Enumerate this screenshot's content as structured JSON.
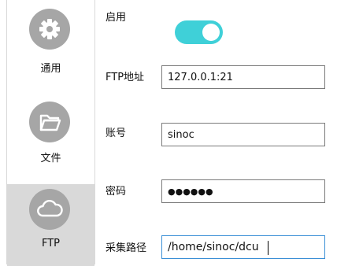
{
  "sidebar": {
    "items": [
      {
        "label": "通用",
        "icon": "gear-icon"
      },
      {
        "label": "文件",
        "icon": "folder-icon"
      },
      {
        "label": "FTP",
        "icon": "cloud-icon"
      }
    ],
    "active_index": 2
  },
  "form": {
    "enable": {
      "label": "启用",
      "on": true
    },
    "ftp_address": {
      "label": "FTP地址",
      "value": "127.0.0.1:21"
    },
    "account": {
      "label": "账号",
      "value": "sinoc"
    },
    "password": {
      "label": "密码",
      "value": "●●●●●●"
    },
    "collect_path": {
      "label": "采集路径",
      "value": "/home/sinoc/dcu"
    }
  },
  "colors": {
    "toggle_on": "#3fd0d8",
    "icon_circle": "#a6a6a6",
    "active_item_bg": "#d9d9d9",
    "focus_border": "#3b8fd6"
  }
}
